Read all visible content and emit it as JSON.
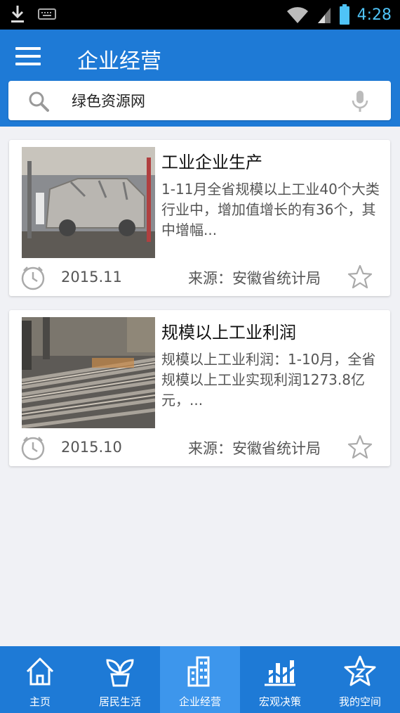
{
  "status_bar": {
    "time": "4:28"
  },
  "header": {
    "title": "企业经营"
  },
  "search": {
    "value": "绿色资源网"
  },
  "articles": [
    {
      "title": "工业企业生产",
      "summary": "1-11月全省规模以上工业40个大类行业中，增加值增长的有36个，其中增幅...",
      "date": "2015.11",
      "source": "来源：安徽省统计局"
    },
    {
      "title": "规模以上工业利润",
      "summary": "规模以上工业利润：1-10月，全省规模以上工业实现利润1273.8亿元，...",
      "date": "2015.10",
      "source": "来源：安徽省统计局"
    }
  ],
  "bottom_nav": [
    {
      "label": "主页",
      "icon": "home-icon"
    },
    {
      "label": "居民生活",
      "icon": "plant-icon"
    },
    {
      "label": "企业经营",
      "icon": "building-icon",
      "active": true
    },
    {
      "label": "宏观决策",
      "icon": "bar-chart-icon"
    },
    {
      "label": "我的空间",
      "icon": "star-badge-icon"
    }
  ],
  "colors": {
    "primary": "#1e7ad6",
    "active_tab": "#3d96ec",
    "background": "#f0f1f5"
  }
}
